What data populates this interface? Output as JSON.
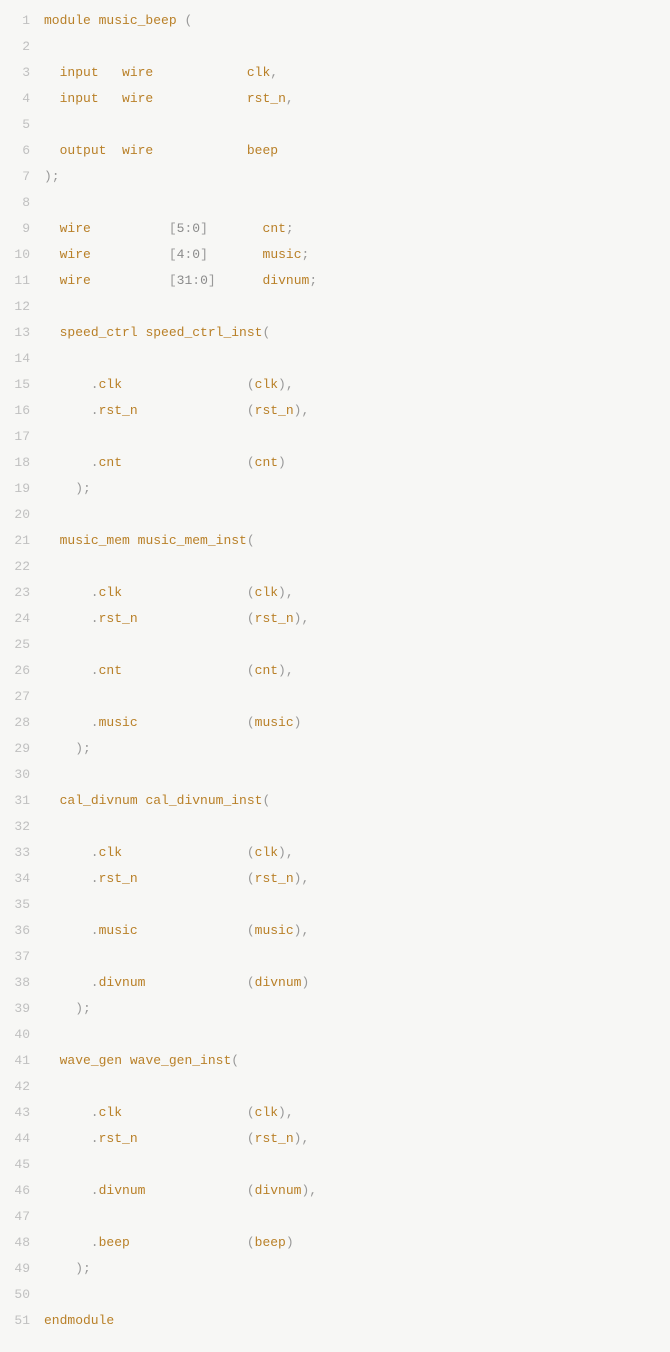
{
  "lines": [
    {
      "n": 1,
      "tokens": [
        [
          "kw",
          "module"
        ],
        [
          "punct",
          " "
        ],
        [
          "id",
          "music_beep"
        ],
        [
          "punct",
          " ("
        ]
      ]
    },
    {
      "n": 2,
      "tokens": []
    },
    {
      "n": 3,
      "tokens": [
        [
          "punct",
          "  "
        ],
        [
          "kw",
          "input"
        ],
        [
          "punct",
          "   "
        ],
        [
          "kw",
          "wire"
        ],
        [
          "punct",
          "            "
        ],
        [
          "sig",
          "clk"
        ],
        [
          "punct",
          ","
        ]
      ]
    },
    {
      "n": 4,
      "tokens": [
        [
          "punct",
          "  "
        ],
        [
          "kw",
          "input"
        ],
        [
          "punct",
          "   "
        ],
        [
          "kw",
          "wire"
        ],
        [
          "punct",
          "            "
        ],
        [
          "sig",
          "rst_n"
        ],
        [
          "punct",
          ","
        ]
      ]
    },
    {
      "n": 5,
      "tokens": []
    },
    {
      "n": 6,
      "tokens": [
        [
          "punct",
          "  "
        ],
        [
          "kw",
          "output"
        ],
        [
          "punct",
          "  "
        ],
        [
          "kw",
          "wire"
        ],
        [
          "punct",
          "            "
        ],
        [
          "sig",
          "beep"
        ]
      ]
    },
    {
      "n": 7,
      "tokens": [
        [
          "punct",
          ");"
        ]
      ]
    },
    {
      "n": 8,
      "tokens": []
    },
    {
      "n": 9,
      "tokens": [
        [
          "punct",
          "  "
        ],
        [
          "kw",
          "wire"
        ],
        [
          "punct",
          "          ["
        ],
        [
          "num",
          "5"
        ],
        [
          "punct",
          ":"
        ],
        [
          "num",
          "0"
        ],
        [
          "punct",
          "]       "
        ],
        [
          "sig",
          "cnt"
        ],
        [
          "punct",
          ";"
        ]
      ]
    },
    {
      "n": 10,
      "tokens": [
        [
          "punct",
          "  "
        ],
        [
          "kw",
          "wire"
        ],
        [
          "punct",
          "          ["
        ],
        [
          "num",
          "4"
        ],
        [
          "punct",
          ":"
        ],
        [
          "num",
          "0"
        ],
        [
          "punct",
          "]       "
        ],
        [
          "sig",
          "music"
        ],
        [
          "punct",
          ";"
        ]
      ]
    },
    {
      "n": 11,
      "tokens": [
        [
          "punct",
          "  "
        ],
        [
          "kw",
          "wire"
        ],
        [
          "punct",
          "          ["
        ],
        [
          "num",
          "31"
        ],
        [
          "punct",
          ":"
        ],
        [
          "num",
          "0"
        ],
        [
          "punct",
          "]      "
        ],
        [
          "sig",
          "divnum"
        ],
        [
          "punct",
          ";"
        ]
      ]
    },
    {
      "n": 12,
      "tokens": []
    },
    {
      "n": 13,
      "tokens": [
        [
          "punct",
          "  "
        ],
        [
          "id",
          "speed_ctrl"
        ],
        [
          "punct",
          " "
        ],
        [
          "id",
          "speed_ctrl_inst"
        ],
        [
          "punct",
          "("
        ]
      ]
    },
    {
      "n": 14,
      "tokens": []
    },
    {
      "n": 15,
      "tokens": [
        [
          "punct",
          "      ."
        ],
        [
          "port",
          "clk"
        ],
        [
          "punct",
          "                ("
        ],
        [
          "sig",
          "clk"
        ],
        [
          "punct",
          "),"
        ]
      ]
    },
    {
      "n": 16,
      "tokens": [
        [
          "punct",
          "      ."
        ],
        [
          "port",
          "rst_n"
        ],
        [
          "punct",
          "              ("
        ],
        [
          "sig",
          "rst_n"
        ],
        [
          "punct",
          "),"
        ]
      ]
    },
    {
      "n": 17,
      "tokens": []
    },
    {
      "n": 18,
      "tokens": [
        [
          "punct",
          "      ."
        ],
        [
          "port",
          "cnt"
        ],
        [
          "punct",
          "                ("
        ],
        [
          "sig",
          "cnt"
        ],
        [
          "punct",
          ")"
        ]
      ]
    },
    {
      "n": 19,
      "tokens": [
        [
          "punct",
          "    );"
        ]
      ]
    },
    {
      "n": 20,
      "tokens": []
    },
    {
      "n": 21,
      "tokens": [
        [
          "punct",
          "  "
        ],
        [
          "id",
          "music_mem"
        ],
        [
          "punct",
          " "
        ],
        [
          "id",
          "music_mem_inst"
        ],
        [
          "punct",
          "("
        ]
      ]
    },
    {
      "n": 22,
      "tokens": []
    },
    {
      "n": 23,
      "tokens": [
        [
          "punct",
          "      ."
        ],
        [
          "port",
          "clk"
        ],
        [
          "punct",
          "                ("
        ],
        [
          "sig",
          "clk"
        ],
        [
          "punct",
          "),"
        ]
      ]
    },
    {
      "n": 24,
      "tokens": [
        [
          "punct",
          "      ."
        ],
        [
          "port",
          "rst_n"
        ],
        [
          "punct",
          "              ("
        ],
        [
          "sig",
          "rst_n"
        ],
        [
          "punct",
          "),"
        ]
      ]
    },
    {
      "n": 25,
      "tokens": []
    },
    {
      "n": 26,
      "tokens": [
        [
          "punct",
          "      ."
        ],
        [
          "port",
          "cnt"
        ],
        [
          "punct",
          "                ("
        ],
        [
          "sig",
          "cnt"
        ],
        [
          "punct",
          "),"
        ]
      ]
    },
    {
      "n": 27,
      "tokens": []
    },
    {
      "n": 28,
      "tokens": [
        [
          "punct",
          "      ."
        ],
        [
          "port",
          "music"
        ],
        [
          "punct",
          "              ("
        ],
        [
          "sig",
          "music"
        ],
        [
          "punct",
          ")"
        ]
      ]
    },
    {
      "n": 29,
      "tokens": [
        [
          "punct",
          "    );"
        ]
      ]
    },
    {
      "n": 30,
      "tokens": []
    },
    {
      "n": 31,
      "tokens": [
        [
          "punct",
          "  "
        ],
        [
          "id",
          "cal_divnum"
        ],
        [
          "punct",
          " "
        ],
        [
          "id",
          "cal_divnum_inst"
        ],
        [
          "punct",
          "("
        ]
      ]
    },
    {
      "n": 32,
      "tokens": []
    },
    {
      "n": 33,
      "tokens": [
        [
          "punct",
          "      ."
        ],
        [
          "port",
          "clk"
        ],
        [
          "punct",
          "                ("
        ],
        [
          "sig",
          "clk"
        ],
        [
          "punct",
          "),"
        ]
      ]
    },
    {
      "n": 34,
      "tokens": [
        [
          "punct",
          "      ."
        ],
        [
          "port",
          "rst_n"
        ],
        [
          "punct",
          "              ("
        ],
        [
          "sig",
          "rst_n"
        ],
        [
          "punct",
          "),"
        ]
      ]
    },
    {
      "n": 35,
      "tokens": []
    },
    {
      "n": 36,
      "tokens": [
        [
          "punct",
          "      ."
        ],
        [
          "port",
          "music"
        ],
        [
          "punct",
          "              ("
        ],
        [
          "sig",
          "music"
        ],
        [
          "punct",
          "),"
        ]
      ]
    },
    {
      "n": 37,
      "tokens": []
    },
    {
      "n": 38,
      "tokens": [
        [
          "punct",
          "      ."
        ],
        [
          "port",
          "divnum"
        ],
        [
          "punct",
          "             ("
        ],
        [
          "sig",
          "divnum"
        ],
        [
          "punct",
          ")"
        ]
      ]
    },
    {
      "n": 39,
      "tokens": [
        [
          "punct",
          "    );"
        ]
      ]
    },
    {
      "n": 40,
      "tokens": []
    },
    {
      "n": 41,
      "tokens": [
        [
          "punct",
          "  "
        ],
        [
          "id",
          "wave_gen"
        ],
        [
          "punct",
          " "
        ],
        [
          "id",
          "wave_gen_inst"
        ],
        [
          "punct",
          "("
        ]
      ]
    },
    {
      "n": 42,
      "tokens": []
    },
    {
      "n": 43,
      "tokens": [
        [
          "punct",
          "      ."
        ],
        [
          "port",
          "clk"
        ],
        [
          "punct",
          "                ("
        ],
        [
          "sig",
          "clk"
        ],
        [
          "punct",
          "),"
        ]
      ]
    },
    {
      "n": 44,
      "tokens": [
        [
          "punct",
          "      ."
        ],
        [
          "port",
          "rst_n"
        ],
        [
          "punct",
          "              ("
        ],
        [
          "sig",
          "rst_n"
        ],
        [
          "punct",
          "),"
        ]
      ]
    },
    {
      "n": 45,
      "tokens": []
    },
    {
      "n": 46,
      "tokens": [
        [
          "punct",
          "      ."
        ],
        [
          "port",
          "divnum"
        ],
        [
          "punct",
          "             ("
        ],
        [
          "sig",
          "divnum"
        ],
        [
          "punct",
          "),"
        ]
      ]
    },
    {
      "n": 47,
      "tokens": []
    },
    {
      "n": 48,
      "tokens": [
        [
          "punct",
          "      ."
        ],
        [
          "port",
          "beep"
        ],
        [
          "punct",
          "               ("
        ],
        [
          "sig",
          "beep"
        ],
        [
          "punct",
          ")"
        ]
      ]
    },
    {
      "n": 49,
      "tokens": [
        [
          "punct",
          "    );"
        ]
      ]
    },
    {
      "n": 50,
      "tokens": []
    },
    {
      "n": 51,
      "tokens": [
        [
          "kw",
          "endmodule"
        ]
      ]
    }
  ]
}
